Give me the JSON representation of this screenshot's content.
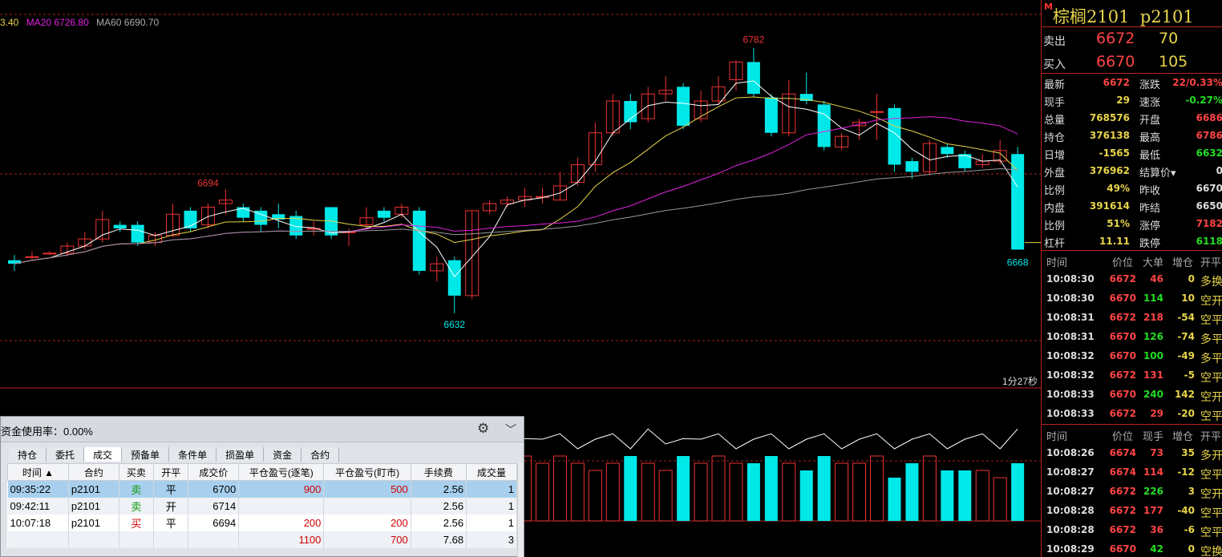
{
  "ma_legend": {
    "ma5": "3.40",
    "ma20": "MA20 6726.80",
    "ma60": "MA60 6690.70"
  },
  "chart_labels": {
    "high": "6782",
    "local_high": "6694",
    "low": "6632",
    "last": "6668",
    "countdown": "1分27秒"
  },
  "chart_data": {
    "type": "candlestick",
    "price_range": [
      6600,
      6800
    ],
    "candles": [
      {
        "o": 6662,
        "h": 6665,
        "c": 6660,
        "l": 6656
      },
      {
        "o": 6664,
        "h": 6667,
        "c": 6664,
        "l": 6662
      },
      {
        "o": 6666,
        "h": 6667,
        "c": 6666,
        "l": 6665
      },
      {
        "o": 6666,
        "h": 6672,
        "c": 6670,
        "l": 6664
      },
      {
        "o": 6670,
        "h": 6678,
        "c": 6674,
        "l": 6668
      },
      {
        "o": 6674,
        "h": 6690,
        "c": 6685,
        "l": 6672
      },
      {
        "o": 6682,
        "h": 6684,
        "c": 6680,
        "l": 6678
      },
      {
        "o": 6682,
        "h": 6684,
        "c": 6672,
        "l": 6670
      },
      {
        "o": 6672,
        "h": 6678,
        "c": 6676,
        "l": 6670
      },
      {
        "o": 6676,
        "h": 6694,
        "c": 6688,
        "l": 6675
      },
      {
        "o": 6690,
        "h": 6692,
        "c": 6680,
        "l": 6678
      },
      {
        "o": 6682,
        "h": 6694,
        "c": 6692,
        "l": 6680
      },
      {
        "o": 6694,
        "h": 6702,
        "c": 6696,
        "l": 6688
      },
      {
        "o": 6692,
        "h": 6694,
        "c": 6686,
        "l": 6684
      },
      {
        "o": 6690,
        "h": 6692,
        "c": 6682,
        "l": 6678
      },
      {
        "o": 6688,
        "h": 6694,
        "c": 6685,
        "l": 6680
      },
      {
        "o": 6687,
        "h": 6690,
        "c": 6676,
        "l": 6674
      },
      {
        "o": 6680,
        "h": 6684,
        "c": 6680,
        "l": 6676
      },
      {
        "o": 6692,
        "h": 6692,
        "c": 6676,
        "l": 6674
      },
      {
        "o": 6678,
        "h": 6680,
        "c": 6678,
        "l": 6670
      },
      {
        "o": 6682,
        "h": 6692,
        "c": 6686,
        "l": 6680
      },
      {
        "o": 6690,
        "h": 6692,
        "c": 6686,
        "l": 6684
      },
      {
        "o": 6688,
        "h": 6694,
        "c": 6692,
        "l": 6686
      },
      {
        "o": 6690,
        "h": 6692,
        "c": 6656,
        "l": 6654
      },
      {
        "o": 6656,
        "h": 6664,
        "c": 6660,
        "l": 6650
      },
      {
        "o": 6662,
        "h": 6664,
        "c": 6642,
        "l": 6632
      },
      {
        "o": 6642,
        "h": 6690,
        "c": 6690,
        "l": 6640
      },
      {
        "o": 6690,
        "h": 6696,
        "c": 6694,
        "l": 6688
      },
      {
        "o": 6694,
        "h": 6698,
        "c": 6696,
        "l": 6692
      },
      {
        "o": 6696,
        "h": 6703,
        "c": 6698,
        "l": 6692
      },
      {
        "o": 6698,
        "h": 6703,
        "c": 6698,
        "l": 6694
      },
      {
        "o": 6696,
        "h": 6712,
        "c": 6704,
        "l": 6696
      },
      {
        "o": 6706,
        "h": 6720,
        "c": 6716,
        "l": 6704
      },
      {
        "o": 6716,
        "h": 6740,
        "c": 6734,
        "l": 6712
      },
      {
        "o": 6734,
        "h": 6756,
        "c": 6752,
        "l": 6732
      },
      {
        "o": 6752,
        "h": 6756,
        "c": 6740,
        "l": 6736
      },
      {
        "o": 6742,
        "h": 6760,
        "c": 6756,
        "l": 6740
      },
      {
        "o": 6756,
        "h": 6766,
        "c": 6758,
        "l": 6752
      },
      {
        "o": 6760,
        "h": 6762,
        "c": 6738,
        "l": 6736
      },
      {
        "o": 6742,
        "h": 6758,
        "c": 6752,
        "l": 6740
      },
      {
        "o": 6752,
        "h": 6766,
        "c": 6760,
        "l": 6750
      },
      {
        "o": 6764,
        "h": 6775,
        "c": 6774,
        "l": 6758
      },
      {
        "o": 6774,
        "h": 6782,
        "c": 6756,
        "l": 6754
      },
      {
        "o": 6754,
        "h": 6756,
        "c": 6734,
        "l": 6732
      },
      {
        "o": 6734,
        "h": 6764,
        "c": 6756,
        "l": 6732
      },
      {
        "o": 6756,
        "h": 6768,
        "c": 6752,
        "l": 6750
      },
      {
        "o": 6750,
        "h": 6752,
        "c": 6726,
        "l": 6724
      },
      {
        "o": 6726,
        "h": 6734,
        "c": 6732,
        "l": 6724
      },
      {
        "o": 6738,
        "h": 6742,
        "c": 6740,
        "l": 6730
      },
      {
        "o": 6746,
        "h": 6756,
        "c": 6746,
        "l": 6730
      },
      {
        "o": 6748,
        "h": 6750,
        "c": 6716,
        "l": 6712
      },
      {
        "o": 6718,
        "h": 6720,
        "c": 6712,
        "l": 6708
      },
      {
        "o": 6712,
        "h": 6730,
        "c": 6728,
        "l": 6710
      },
      {
        "o": 6726,
        "h": 6728,
        "c": 6722,
        "l": 6720
      },
      {
        "o": 6722,
        "h": 6724,
        "c": 6714,
        "l": 6712
      },
      {
        "o": 6716,
        "h": 6722,
        "c": 6718,
        "l": 6714
      },
      {
        "o": 6718,
        "h": 6730,
        "c": 6724,
        "l": 6716
      },
      {
        "o": 6722,
        "h": 6726,
        "c": 6668,
        "l": 6668
      }
    ],
    "volume": [
      8,
      9,
      7,
      8,
      9,
      8,
      9,
      8,
      9,
      6,
      9,
      8,
      9,
      8,
      9,
      7,
      8,
      6,
      8,
      6,
      9,
      7,
      8,
      9,
      8,
      7,
      9,
      9,
      8,
      9,
      8,
      9,
      8,
      7,
      8,
      9,
      8,
      7,
      9,
      8,
      9,
      8,
      8,
      9,
      8,
      7,
      9,
      8,
      8,
      9,
      6,
      8,
      9,
      7,
      7,
      7,
      6,
      8
    ],
    "volume_line": [
      9,
      8,
      8,
      9,
      9,
      8,
      9,
      8,
      9,
      9,
      8,
      9,
      8,
      9,
      8,
      8,
      9,
      8,
      8,
      9,
      8,
      9,
      8,
      9,
      8,
      8,
      9,
      9,
      8,
      9,
      8,
      9,
      8,
      8,
      9,
      8,
      9,
      8,
      9,
      8,
      9,
      8,
      8,
      9,
      8,
      8,
      9,
      8,
      8,
      9,
      8,
      8,
      9,
      8,
      8,
      9,
      8,
      9
    ]
  },
  "quote": {
    "mark": "M",
    "name": "棕榈2101",
    "code": "p2101",
    "ask_label": "卖出",
    "ask_price": "6672",
    "ask_qty": "70",
    "bid_label": "买入",
    "bid_price": "6670",
    "bid_qty": "105",
    "stats": [
      {
        "l1": "最新",
        "v1": "6672",
        "c1": "#ff4444",
        "l2": "涨跌",
        "v2": "22/0.33%",
        "c2": "#ff4444"
      },
      {
        "l1": "现手",
        "v1": "29",
        "c1": "#e8d44a",
        "l2": "速涨",
        "v2": "-0.27%",
        "c2": "#22dd22"
      },
      {
        "l1": "总量",
        "v1": "768576",
        "c1": "#e8d44a",
        "l2": "开盘",
        "v2": "6686",
        "c2": "#ff4444"
      },
      {
        "l1": "持仓",
        "v1": "376138",
        "c1": "#e8d44a",
        "l2": "最高",
        "v2": "6786",
        "c2": "#ff4444"
      },
      {
        "l1": "日增",
        "v1": "-1565",
        "c1": "#e8d44a",
        "l2": "最低",
        "v2": "6632",
        "c2": "#22dd22"
      },
      {
        "l1": "外盘",
        "v1": "376962",
        "c1": "#e8d44a",
        "l2": "结算价▾",
        "v2": "0",
        "c2": "#ddd"
      },
      {
        "l1": "比例",
        "v1": "49%",
        "c1": "#e8d44a",
        "l2": "昨收",
        "v2": "6670",
        "c2": "#ddd"
      },
      {
        "l1": "内盘",
        "v1": "391614",
        "c1": "#e8d44a",
        "l2": "昨结",
        "v2": "6650",
        "c2": "#ddd"
      },
      {
        "l1": "比例",
        "v1": "51%",
        "c1": "#e8d44a",
        "l2": "涨停",
        "v2": "7182",
        "c2": "#ff4444"
      },
      {
        "l1": "杠杆",
        "v1": "11.11",
        "c1": "#e8d44a",
        "l2": "跌停",
        "v2": "6118",
        "c2": "#22dd22"
      }
    ],
    "tick_head_1": [
      "时间",
      "价位",
      "大单",
      "增仓",
      "开平"
    ],
    "ticks_1": [
      {
        "t": "10:08:30",
        "p": "6672",
        "pc": "#ff4444",
        "v": "46",
        "vc": "#ff4444",
        "o": "0",
        "oc": "#e8d44a",
        "k": "多换",
        "kc": "#e8d44a"
      },
      {
        "t": "10:08:30",
        "p": "6670",
        "pc": "#ff4444",
        "v": "114",
        "vc": "#22dd22",
        "o": "10",
        "oc": "#e8d44a",
        "k": "空开",
        "kc": "#e8d44a"
      },
      {
        "t": "10:08:31",
        "p": "6672",
        "pc": "#ff4444",
        "v": "218",
        "vc": "#ff4444",
        "o": "-54",
        "oc": "#e8d44a",
        "k": "空平",
        "kc": "#e8d44a"
      },
      {
        "t": "10:08:31",
        "p": "6670",
        "pc": "#ff4444",
        "v": "126",
        "vc": "#22dd22",
        "o": "-74",
        "oc": "#e8d44a",
        "k": "多平",
        "kc": "#e8d44a"
      },
      {
        "t": "10:08:32",
        "p": "6670",
        "pc": "#ff4444",
        "v": "100",
        "vc": "#22dd22",
        "o": "-49",
        "oc": "#e8d44a",
        "k": "多平",
        "kc": "#e8d44a"
      },
      {
        "t": "10:08:32",
        "p": "6672",
        "pc": "#ff4444",
        "v": "131",
        "vc": "#ff4444",
        "o": "-5",
        "oc": "#e8d44a",
        "k": "空平",
        "kc": "#e8d44a"
      },
      {
        "t": "10:08:33",
        "p": "6670",
        "pc": "#ff4444",
        "v": "240",
        "vc": "#22dd22",
        "o": "142",
        "oc": "#e8d44a",
        "k": "空开",
        "kc": "#e8d44a"
      },
      {
        "t": "10:08:33",
        "p": "6672",
        "pc": "#ff4444",
        "v": "29",
        "vc": "#ff4444",
        "o": "-20",
        "oc": "#e8d44a",
        "k": "空平",
        "kc": "#e8d44a"
      }
    ],
    "tick_head_2": [
      "时间",
      "价位",
      "现手",
      "增仓",
      "开平"
    ],
    "ticks_2": [
      {
        "t": "10:08:26",
        "p": "6674",
        "pc": "#ff4444",
        "v": "73",
        "vc": "#ff4444",
        "o": "35",
        "oc": "#e8d44a",
        "k": "多开",
        "kc": "#e8d44a"
      },
      {
        "t": "10:08:27",
        "p": "6674",
        "pc": "#ff4444",
        "v": "114",
        "vc": "#ff4444",
        "o": "-12",
        "oc": "#e8d44a",
        "k": "空平",
        "kc": "#e8d44a"
      },
      {
        "t": "10:08:27",
        "p": "6672",
        "pc": "#ff4444",
        "v": "226",
        "vc": "#22dd22",
        "o": "3",
        "oc": "#e8d44a",
        "k": "空开",
        "kc": "#e8d44a"
      },
      {
        "t": "10:08:28",
        "p": "6672",
        "pc": "#ff4444",
        "v": "177",
        "vc": "#ff4444",
        "o": "-40",
        "oc": "#e8d44a",
        "k": "空平",
        "kc": "#e8d44a"
      },
      {
        "t": "10:08:28",
        "p": "6672",
        "pc": "#ff4444",
        "v": "36",
        "vc": "#ff4444",
        "o": "-6",
        "oc": "#e8d44a",
        "k": "空平",
        "kc": "#e8d44a"
      },
      {
        "t": "10:08:29",
        "p": "6670",
        "pc": "#ff4444",
        "v": "42",
        "vc": "#22dd22",
        "o": "0",
        "oc": "#e8d44a",
        "k": "空换",
        "kc": "#e8d44a"
      }
    ]
  },
  "trade_window": {
    "title": "资金使用率：0.00%",
    "tabs": [
      "持仓",
      "委托",
      "成交",
      "预备单",
      "条件单",
      "损盈单",
      "资金",
      "合约"
    ],
    "active_tab": 2,
    "columns": [
      "时间 ▲",
      "合约",
      "买卖",
      "开平",
      "成交价",
      "平仓盈亏(逐笔)",
      "平仓盈亏(盯市)",
      "手续费",
      "成交量"
    ],
    "rows": [
      {
        "time": "09:35:22",
        "contract": "p2101",
        "side": "卖",
        "side_color": "green",
        "oc": "平",
        "price": "6700",
        "pnl1": "900",
        "pnl2": "500",
        "fee": "2.56",
        "vol": "1"
      },
      {
        "time": "09:42:11",
        "contract": "p2101",
        "side": "卖",
        "side_color": "green",
        "oc": "开",
        "price": "6714",
        "pnl1": "",
        "pnl2": "",
        "fee": "2.56",
        "vol": "1"
      },
      {
        "time": "10:07:18",
        "contract": "p2101",
        "side": "买",
        "side_color": "red",
        "oc": "平",
        "price": "6694",
        "pnl1": "200",
        "pnl2": "200",
        "fee": "2.56",
        "vol": "1"
      }
    ],
    "total": {
      "pnl1": "1100",
      "pnl2": "700",
      "fee": "7.68",
      "vol": "3"
    }
  }
}
